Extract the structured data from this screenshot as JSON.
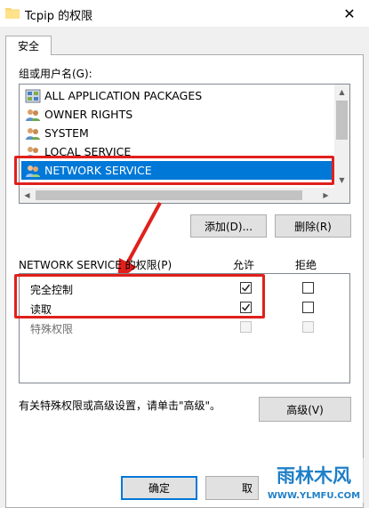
{
  "window": {
    "title": "Tcpip 的权限",
    "close_glyph": "✕"
  },
  "tabs": [
    {
      "label": "安全"
    }
  ],
  "group_section": {
    "label": "组或用户名(G):",
    "items": [
      {
        "label": "ALL APPLICATION PACKAGES",
        "icon": "package-group-icon"
      },
      {
        "label": "OWNER RIGHTS",
        "icon": "users-icon"
      },
      {
        "label": "SYSTEM",
        "icon": "users-icon"
      },
      {
        "label": "LOCAL SERVICE",
        "icon": "users-icon"
      },
      {
        "label": "NETWORK SERVICE",
        "icon": "users-icon",
        "selected": true
      }
    ],
    "add_button": "添加(D)...",
    "remove_button": "删除(R)"
  },
  "permissions": {
    "label": "NETWORK SERVICE 的权限(P)",
    "allow_header": "允许",
    "deny_header": "拒绝",
    "rows": [
      {
        "name": "完全控制",
        "allow": true,
        "deny": false,
        "enabled": true
      },
      {
        "name": "读取",
        "allow": true,
        "deny": false,
        "enabled": true
      },
      {
        "name": "特殊权限",
        "allow": false,
        "deny": false,
        "enabled": false
      }
    ]
  },
  "advanced": {
    "note": "有关特殊权限或高级设置，请单击\"高级\"。",
    "button": "高级(V)"
  },
  "footer": {
    "ok_button": "确定",
    "cancel_button_partial": "取"
  },
  "watermark": {
    "text": "雨林木风",
    "url": "WWW.YLMFU.COM"
  },
  "colors": {
    "selection": "#0078d7",
    "annotation": "#e0201c"
  }
}
